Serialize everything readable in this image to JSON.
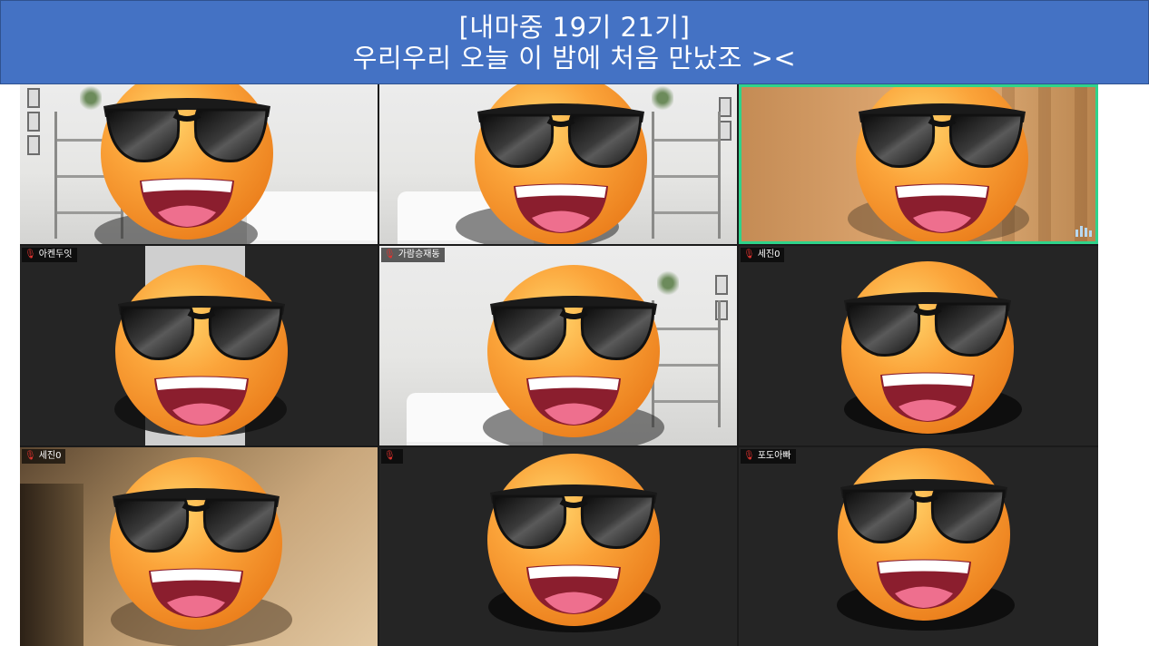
{
  "banner": {
    "line1": "[내마중 19기 21기]",
    "line2": "우리우리 오늘 이 밤에 처음 만났조 ><"
  },
  "tiles": [
    {
      "name": "",
      "background": "room"
    },
    {
      "name": "",
      "background": "room"
    },
    {
      "name": "",
      "background": "curtain",
      "active_speaker": true
    },
    {
      "name": "아켄두잇",
      "background": "dark"
    },
    {
      "name": "가람승재동",
      "background": "room"
    },
    {
      "name": "세진0",
      "background": "dark"
    },
    {
      "name": "세진0",
      "background": "car"
    },
    {
      "name": "",
      "background": "dark"
    },
    {
      "name": "포도아빠",
      "background": "dark"
    }
  ],
  "colors": {
    "banner": "#4472c4",
    "active_speaker_border": "#2fd38a",
    "muted_mic": "#e0332e",
    "emoji_face": "#f89a2c"
  },
  "icons": {
    "mic_muted": "muted-microphone-icon",
    "audio": "audio-level-icon",
    "overlay": "sunglasses-emoji"
  }
}
